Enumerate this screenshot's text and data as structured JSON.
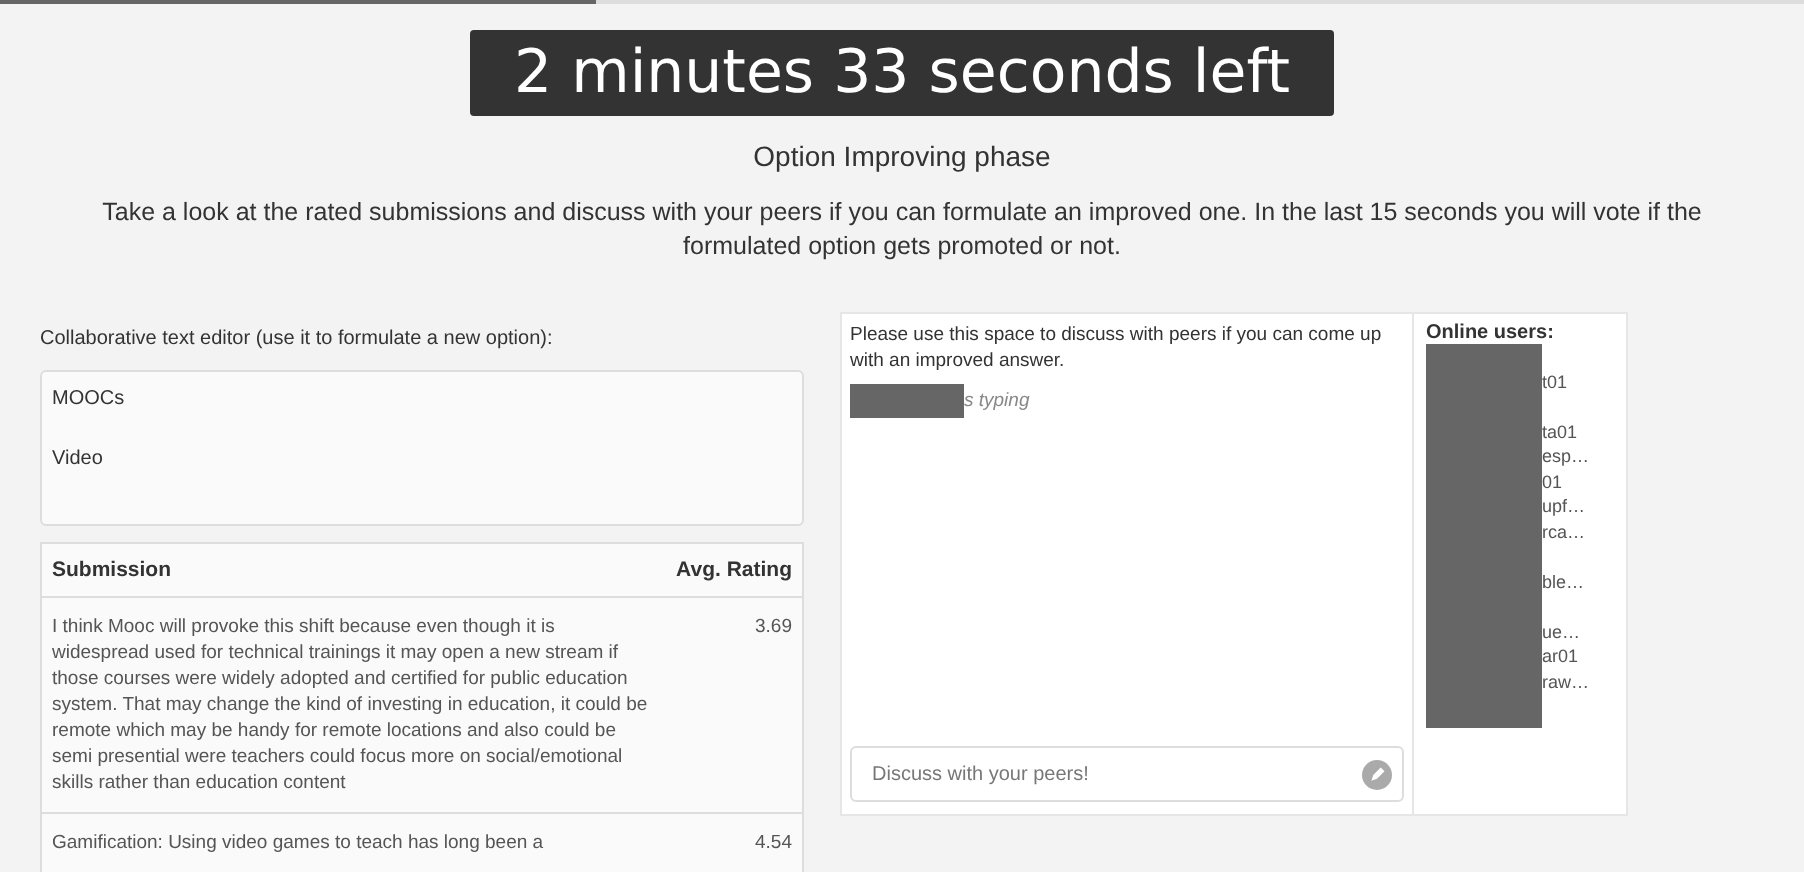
{
  "progress": {
    "level": 0.33
  },
  "timer": "2 minutes 33 seconds left",
  "phase": "Option Improving phase",
  "instructions": "Take a look at the rated submissions and discuss with your peers if you can formulate an improved one. In the last 15 seconds you will vote if the formulated option gets promoted or not.",
  "editor": {
    "label": "Collaborative text editor (use it to formulate a new option):",
    "lines": [
      "MOOCs",
      "Video"
    ]
  },
  "table": {
    "columns": [
      "Submission",
      "Avg. Rating"
    ],
    "rows": [
      {
        "submission": "I think Mooc will provoke this shift because even though it is widespread used for technical trainings it may open a new stream if those courses were widely adopted and certified for public education system. That may change the kind of investing in education, it could be remote which may be handy for remote locations and also could be semi presential were teachers could focus more on social/emotional skills rather than education content",
        "rating": "3.69"
      },
      {
        "submission": "Gamification: Using video games to teach has long been a",
        "rating": "4.54"
      }
    ]
  },
  "chat": {
    "intro": "Please use this space to discuss with peers if you can come up with an improved answer.",
    "typing": "s typing",
    "input": {
      "placeholder": "Discuss with your peers!"
    }
  },
  "users": {
    "title": "Online users:",
    "groups": [
      [
        "t01"
      ],
      [
        "ta01",
        "esp…",
        "01",
        "upf…",
        "rca…"
      ],
      [
        "ble…"
      ],
      [
        "ue…",
        "ar01",
        "raw…"
      ]
    ]
  }
}
